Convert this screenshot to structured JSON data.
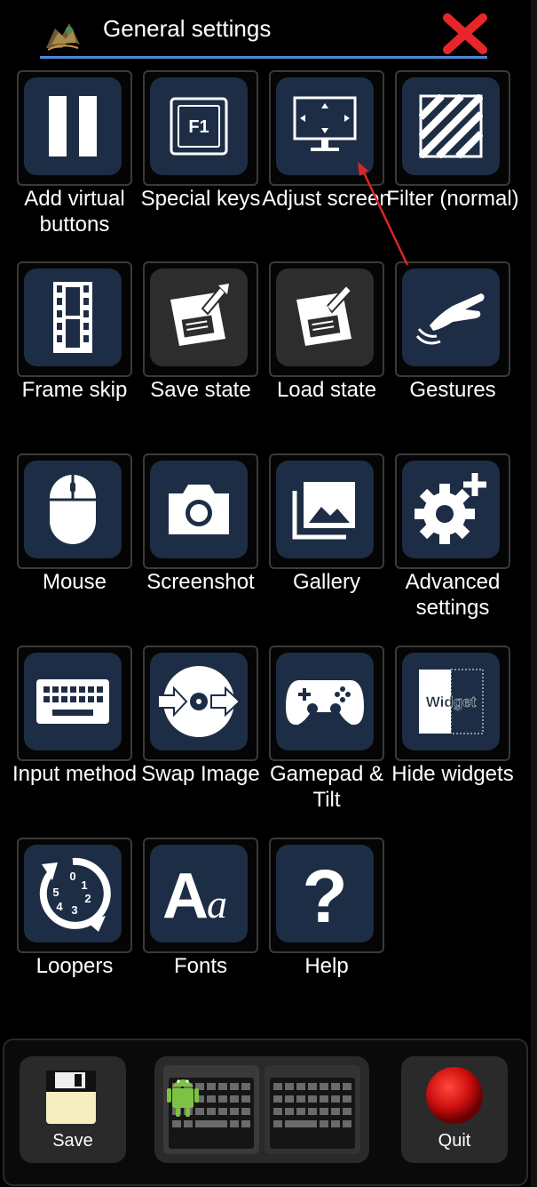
{
  "header": {
    "title": "General settings",
    "close_icon": "close-icon",
    "logo_icon": "app-logo"
  },
  "grid": {
    "tiles": [
      {
        "label": "Add virtual buttons",
        "icon": "pause-icon"
      },
      {
        "label": "Special keys",
        "icon": "f1-key-icon",
        "key_text": "F1"
      },
      {
        "label": "Adjust screen",
        "icon": "monitor-icon"
      },
      {
        "label": "Filter (normal)",
        "icon": "stripes-icon"
      },
      {
        "label": "Frame skip",
        "icon": "film-strip-icon"
      },
      {
        "label": "Save state",
        "icon": "floppy-save-icon"
      },
      {
        "label": "Load state",
        "icon": "floppy-load-icon"
      },
      {
        "label": "Gestures",
        "icon": "hand-gesture-icon"
      },
      {
        "label": "Mouse",
        "icon": "mouse-icon"
      },
      {
        "label": "Screenshot",
        "icon": "camera-icon"
      },
      {
        "label": "Gallery",
        "icon": "gallery-icon"
      },
      {
        "label": "Advanced settings",
        "icon": "gear-plus-icon"
      },
      {
        "label": "Input method",
        "icon": "keyboard-icon"
      },
      {
        "label": "Swap Image",
        "icon": "disc-swap-icon"
      },
      {
        "label": "Gamepad & Tilt",
        "icon": "gamepad-icon"
      },
      {
        "label": "Hide widgets",
        "icon": "widget-icon",
        "widget_text": "Widget"
      },
      {
        "label": "Loopers",
        "icon": "looper-icon",
        "digits": [
          "0",
          "1",
          "2",
          "3",
          "4",
          "5"
        ]
      },
      {
        "label": "Fonts",
        "icon": "fonts-icon",
        "big": "A",
        "small": "a"
      },
      {
        "label": "Help",
        "icon": "help-icon",
        "glyph": "?"
      }
    ]
  },
  "bottom": {
    "save_label": "Save",
    "quit_label": "Quit",
    "save_icon": "floppy-icon",
    "keyboard_icon": "android-keyboard-icon",
    "quit_icon": "red-ball-icon"
  },
  "colors": {
    "tile_bg": "#1d2d45",
    "accent_line": "#4b8ad6",
    "close_red": "#e8262a",
    "annotation_arrow": "#d42828"
  }
}
